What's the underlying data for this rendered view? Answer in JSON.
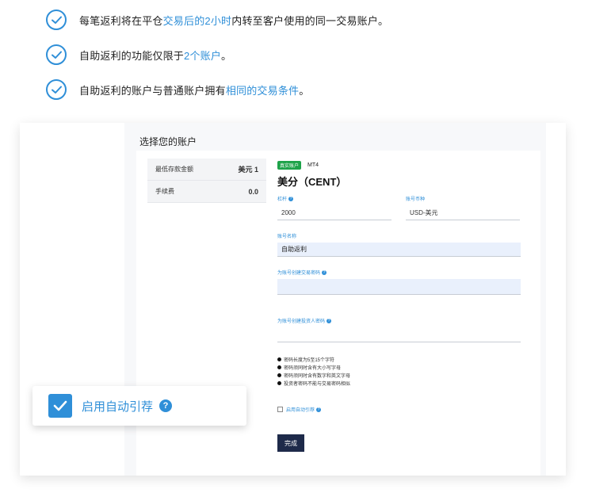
{
  "features": [
    {
      "before": "每笔返利将在平仓",
      "highlight": "交易后的2小时",
      "after": "内转至客户使用的同一交易账户。"
    },
    {
      "before": "自助返利的功能仅限于",
      "highlight": "2个账户",
      "after": "。"
    },
    {
      "before": "自助返利的账户与普通账户拥有",
      "highlight": "相同的交易条件",
      "after": "。"
    }
  ],
  "screen": {
    "title": "选择您的账户",
    "summary": [
      {
        "label": "最低存款金额",
        "value": "美元 1"
      },
      {
        "label": "手续费",
        "value": "0.0"
      }
    ],
    "badge_real": "真实账户",
    "badge_platform": "MT4",
    "account_type": "美分（CENT）",
    "leverage_label": "杠杆",
    "leverage_value": "2000",
    "currency_label": "账号币种",
    "currency_value": "USD-美元",
    "account_name_label": "账号名称",
    "account_name_value": "自助返利",
    "trade_password_label": "为账号创建交易密码",
    "investor_password_label": "为账号创建投资人密码",
    "rules": [
      "密码长度为5至15个字符",
      "密码须同时含有大小写字母",
      "密码须同时含有数字和英文字母",
      "投资者密码不能与交易密码相似"
    ],
    "auto_refer_label": "启用自动引荐",
    "done_label": "完成"
  },
  "callout": {
    "label": "启用自动引荐",
    "help": "?"
  },
  "colors": {
    "accent": "#2f8fd8",
    "orange": "#f59a1b",
    "dark_button": "#1e2a4a",
    "badge_green": "#1ea34a"
  }
}
